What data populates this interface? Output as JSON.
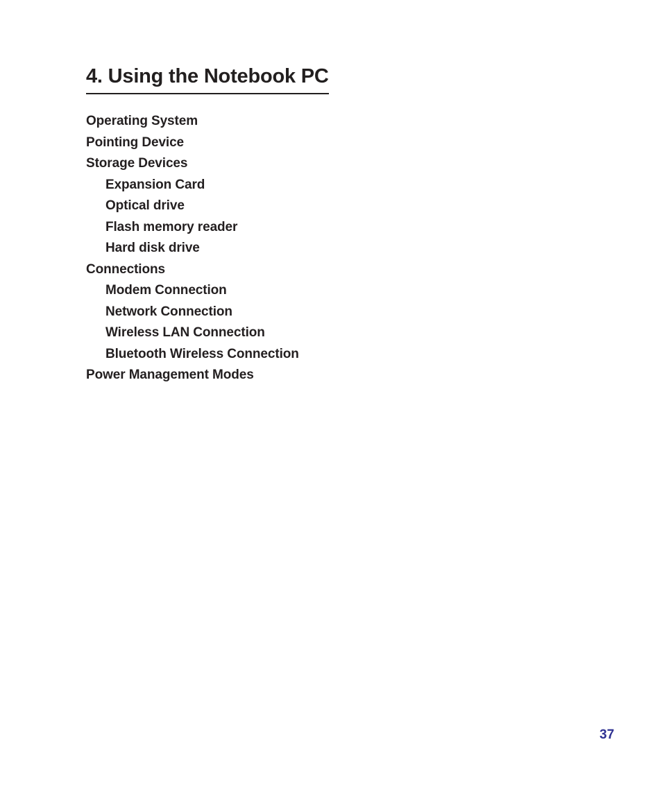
{
  "page": {
    "background_color": "#ffffff",
    "text_color": "#231f20",
    "page_number": "37",
    "page_number_color": "#2e3192"
  },
  "heading": {
    "text": "4. Using the Notebook PC",
    "underline": true
  },
  "toc": {
    "items": [
      {
        "label": "Operating System",
        "level": 1
      },
      {
        "label": "Pointing Device",
        "level": 1
      },
      {
        "label": "Storage Devices",
        "level": 1
      },
      {
        "label": "Expansion Card",
        "level": 2
      },
      {
        "label": "Optical drive",
        "level": 2
      },
      {
        "label": "Flash memory reader",
        "level": 2
      },
      {
        "label": "Hard disk drive",
        "level": 2
      },
      {
        "label": "Connections",
        "level": 1
      },
      {
        "label": "Modem Connection",
        "level": 2
      },
      {
        "label": "Network Connection",
        "level": 2
      },
      {
        "label": "Wireless LAN Connection",
        "level": 2
      },
      {
        "label": "Bluetooth Wireless Connection",
        "level": 2
      },
      {
        "label": "Power Management Modes",
        "level": 1
      }
    ]
  }
}
